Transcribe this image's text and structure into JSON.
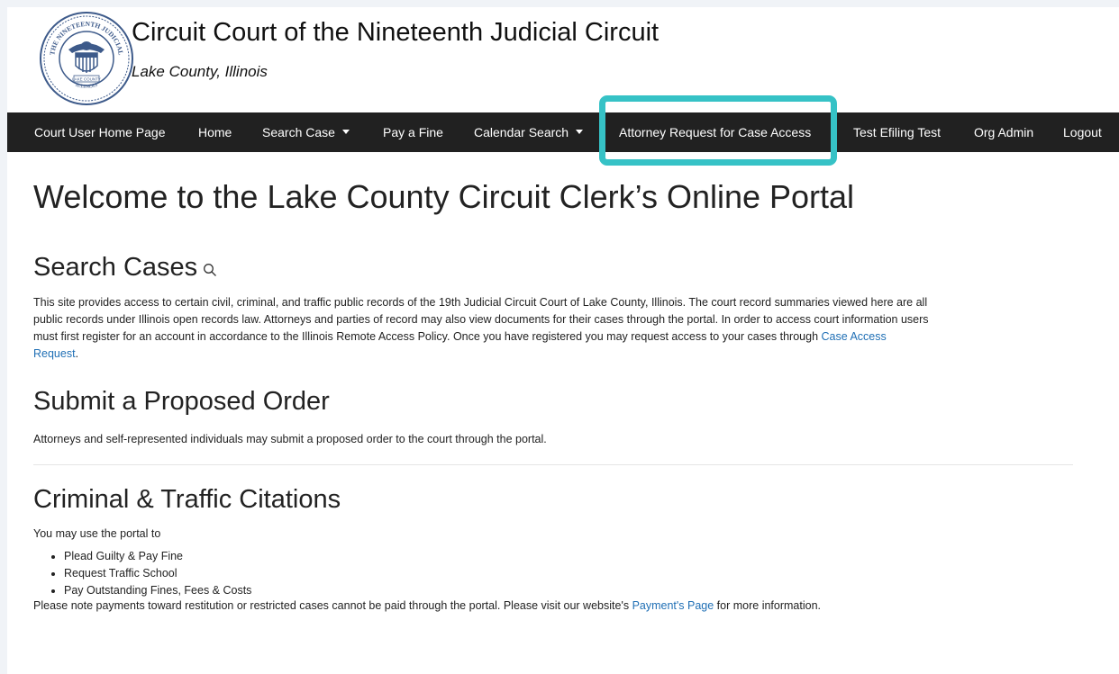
{
  "header": {
    "title": "Circuit Court of the Nineteenth Judicial Circuit",
    "subtitle": "Lake County, Illinois",
    "seal": {
      "top_text": "THE NINETEENTH JUDICIAL",
      "left_text": "CIRCUIT COURT OF",
      "right_text": "CIRCUIT",
      "banner_text": "LAKE COUNTY",
      "bottom_text": "ILLINOIS"
    }
  },
  "nav": {
    "items": [
      {
        "label": "Court User Home Page"
      },
      {
        "label": "Home"
      },
      {
        "label": "Search Case",
        "dropdown": true
      },
      {
        "label": "Pay a Fine"
      },
      {
        "label": "Calendar Search",
        "dropdown": true
      },
      {
        "label": "Attorney Request for Case Access",
        "highlighted": true
      },
      {
        "label": "Test Efiling Test"
      },
      {
        "label": "Org Admin"
      },
      {
        "label": "Logout"
      }
    ]
  },
  "main": {
    "welcome": "Welcome to the Lake County Circuit Clerk’s Online Portal",
    "search_cases": {
      "heading": "Search Cases",
      "icon": "search-icon",
      "text": "This site provides access to certain civil, criminal, and traffic public records of the 19th Judicial Circuit Court of Lake County, Illinois. The court record summaries viewed here are all public records under Illinois open records law. Attorneys and parties of record may also view documents for their cases through the portal. In order to access court information users must first register for an account in accordance to the Illinois Remote Access Policy. Once you have registered you may request access to your cases through ",
      "link": "Case Access Request",
      "suffix": "."
    },
    "proposed_order": {
      "heading": "Submit a Proposed Order",
      "text": "Attorneys and self-represented individuals may submit a proposed order to the court through the portal."
    },
    "citations": {
      "heading": "Criminal & Traffic Citations",
      "intro": "You may use the portal to",
      "items": [
        "Plead Guilty & Pay Fine",
        "Request Traffic School",
        "Pay Outstanding Fines, Fees & Costs"
      ],
      "note": "Please note payments toward restitution or restricted cases cannot be paid through the portal. Please visit our website's ",
      "link": "Payment's Page",
      "note_suffix": " for more information."
    }
  },
  "colors": {
    "navbar": "#212121",
    "highlight": "#36c2c6",
    "link": "#1f6fb5"
  }
}
